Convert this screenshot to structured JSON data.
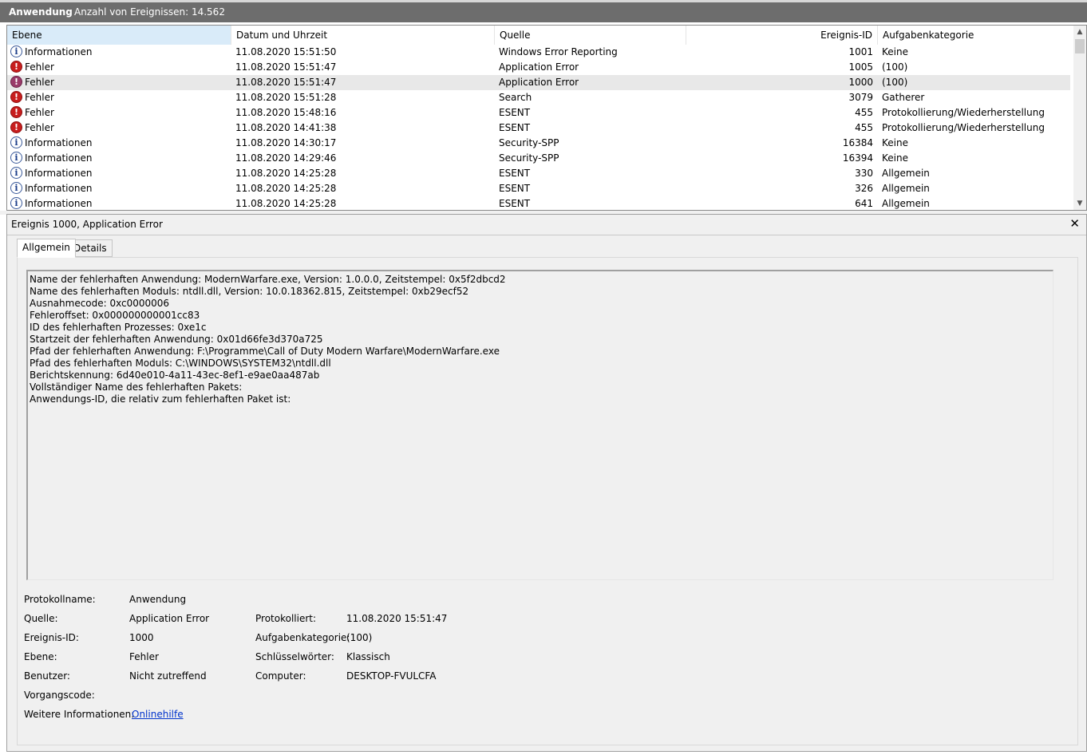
{
  "header": {
    "log_name": "Anwendung",
    "event_count": "Anzahl von Ereignissen: 14.562"
  },
  "grid": {
    "columns": [
      "Ebene",
      "Datum und Uhrzeit",
      "Quelle",
      "Ereignis-ID",
      "Aufgabenkategorie"
    ],
    "rows": [
      {
        "level": "Informationen",
        "icon": "information-icon",
        "date": "11.08.2020 15:51:50",
        "source": "Windows Error Reporting",
        "id": "1001",
        "category": "Keine"
      },
      {
        "level": "Fehler",
        "icon": "error-icon",
        "date": "11.08.2020 15:51:47",
        "source": "Application Error",
        "id": "1005",
        "category": "(100)"
      },
      {
        "level": "Fehler",
        "icon": "error-icon",
        "date": "11.08.2020 15:51:47",
        "source": "Application Error",
        "id": "1000",
        "category": "(100)",
        "selected": true
      },
      {
        "level": "Fehler",
        "icon": "error-icon",
        "date": "11.08.2020 15:51:28",
        "source": "Search",
        "id": "3079",
        "category": "Gatherer"
      },
      {
        "level": "Fehler",
        "icon": "error-icon",
        "date": "11.08.2020 15:48:16",
        "source": "ESENT",
        "id": "455",
        "category": "Protokollierung/Wiederherstellung"
      },
      {
        "level": "Fehler",
        "icon": "error-icon",
        "date": "11.08.2020 14:41:38",
        "source": "ESENT",
        "id": "455",
        "category": "Protokollierung/Wiederherstellung"
      },
      {
        "level": "Informationen",
        "icon": "information-icon",
        "date": "11.08.2020 14:30:17",
        "source": "Security-SPP",
        "id": "16384",
        "category": "Keine"
      },
      {
        "level": "Informationen",
        "icon": "information-icon",
        "date": "11.08.2020 14:29:46",
        "source": "Security-SPP",
        "id": "16394",
        "category": "Keine"
      },
      {
        "level": "Informationen",
        "icon": "information-icon",
        "date": "11.08.2020 14:25:28",
        "source": "ESENT",
        "id": "330",
        "category": "Allgemein"
      },
      {
        "level": "Informationen",
        "icon": "information-icon",
        "date": "11.08.2020 14:25:28",
        "source": "ESENT",
        "id": "326",
        "category": "Allgemein"
      },
      {
        "level": "Informationen",
        "icon": "information-icon",
        "date": "11.08.2020 14:25:28",
        "source": "ESENT",
        "id": "641",
        "category": "Allgemein"
      }
    ]
  },
  "detail": {
    "title": "Ereignis 1000, Application Error",
    "close_glyph": "✕",
    "tabs": [
      "Allgemein",
      "Details"
    ],
    "message_lines": [
      "Name der fehlerhaften Anwendung: ModernWarfare.exe, Version: 1.0.0.0, Zeitstempel: 0x5f2dbcd2",
      "Name des fehlerhaften Moduls: ntdll.dll, Version: 10.0.18362.815, Zeitstempel: 0xb29ecf52",
      "Ausnahmecode: 0xc0000006",
      "Fehleroffset: 0x000000000001cc83",
      "ID des fehlerhaften Prozesses: 0xe1c",
      "Startzeit der fehlerhaften Anwendung: 0x01d66fe3d370a725",
      "Pfad der fehlerhaften Anwendung: F:\\Programme\\Call of Duty Modern Warfare\\ModernWarfare.exe",
      "Pfad des fehlerhaften Moduls: C:\\WINDOWS\\SYSTEM32\\ntdll.dll",
      "Berichtskennung: 6d40e010-4a11-43ec-8ef1-e9ae0aa487ab",
      "Vollständiger Name des fehlerhaften Pakets:",
      "Anwendungs-ID, die relativ zum fehlerhaften Paket ist:"
    ],
    "props": {
      "protokollname_label": "Protokollname:",
      "protokollname": "Anwendung",
      "quelle_label": "Quelle:",
      "quelle": "Application Error",
      "protokolliert_label": "Protokolliert:",
      "protokolliert": "11.08.2020 15:51:47",
      "ereignis_id_label": "Ereignis-ID:",
      "ereignis_id": "1000",
      "aufgabenkategorie_label": "Aufgabenkategorie:",
      "aufgabenkategorie": "(100)",
      "ebene_label": "Ebene:",
      "ebene": "Fehler",
      "schluesselwoerter_label": "Schlüsselwörter:",
      "schluesselwoerter": "Klassisch",
      "benutzer_label": "Benutzer:",
      "benutzer": "Nicht zutreffend",
      "computer_label": "Computer:",
      "computer": "DESKTOP-FVULCFA",
      "vorgangscode_label": "Vorgangscode:",
      "vorgangscode": "",
      "weitere_label": "Weitere Informationen:",
      "weitere_link": "Onlinehilfe"
    }
  }
}
